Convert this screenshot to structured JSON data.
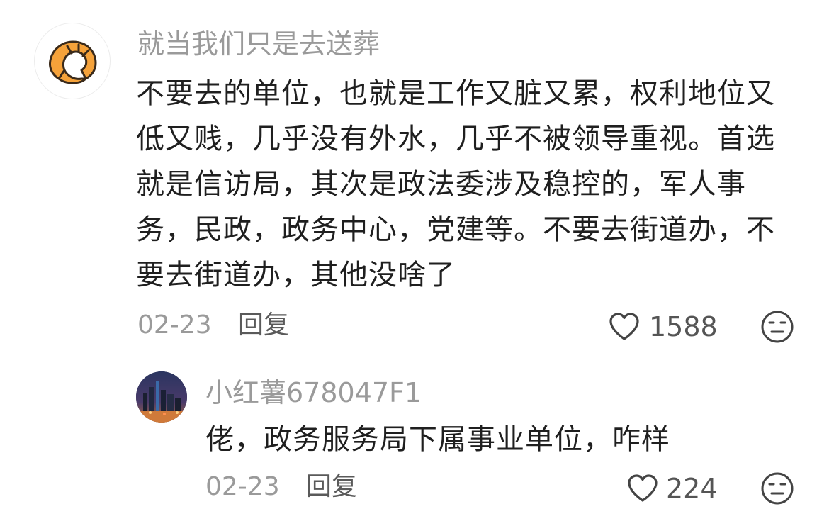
{
  "comment": {
    "username": "就当我们只是去送葬",
    "text_lines": [
      "不要去的单位，也就是工作又脏又累，权利地位又",
      "低又贱，几乎没有外水，几乎不被领导重视。首选",
      "就是信访局，其次是政法委涉及稳控的，军人事",
      "务，民政，政务中心，党建等。不要去街道办，不",
      "要去街道办，其他没啥了"
    ],
    "date": "02-23",
    "reply_label": "回复",
    "like_count": "1588",
    "avatar_icon": "croissant-icon",
    "like_icon": "heart-outline-icon",
    "emoji_icon": "meh-face-icon"
  },
  "reply": {
    "username": "小红薯678047F1",
    "text": "佬，政务服务局下属事业单位，咋样",
    "date": "02-23",
    "reply_label": "回复",
    "like_count": "224",
    "avatar_icon": "city-night-avatar",
    "like_icon": "heart-outline-icon",
    "emoji_icon": "meh-face-icon"
  },
  "colors": {
    "meta_text": "#9a9a9a",
    "body_text": "#1f1f1f",
    "croissant": "#f5a23a"
  }
}
